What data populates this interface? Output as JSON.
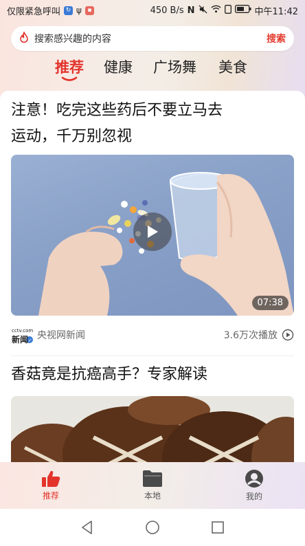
{
  "status_bar": {
    "left_text": "仅限紧急呼叫",
    "speed": "450 B/s",
    "time": "中午11:42"
  },
  "search": {
    "placeholder": "搜索感兴趣的内容",
    "button_label": "搜索"
  },
  "tabs": [
    "推荐",
    "健康",
    "广场舞",
    "美食"
  ],
  "active_tab": "推荐",
  "feed": [
    {
      "title_line1": "注意！吃完这些药后不要立马去",
      "title_line2": "运动，千万别忽视",
      "duration": "07:38",
      "source": "央视网新闻",
      "plays": "3.6万次播放",
      "logo_text": "新闻"
    },
    {
      "title_line1": "香菇竟是抗癌高手？专家解读"
    }
  ],
  "bottom_nav": [
    {
      "label": "推荐",
      "icon": "thumbs-up-icon",
      "active": true
    },
    {
      "label": "本地",
      "icon": "folder-icon",
      "active": false
    },
    {
      "label": "我的",
      "icon": "user-icon",
      "active": false
    }
  ],
  "colors": {
    "accent": "#e3342c"
  }
}
